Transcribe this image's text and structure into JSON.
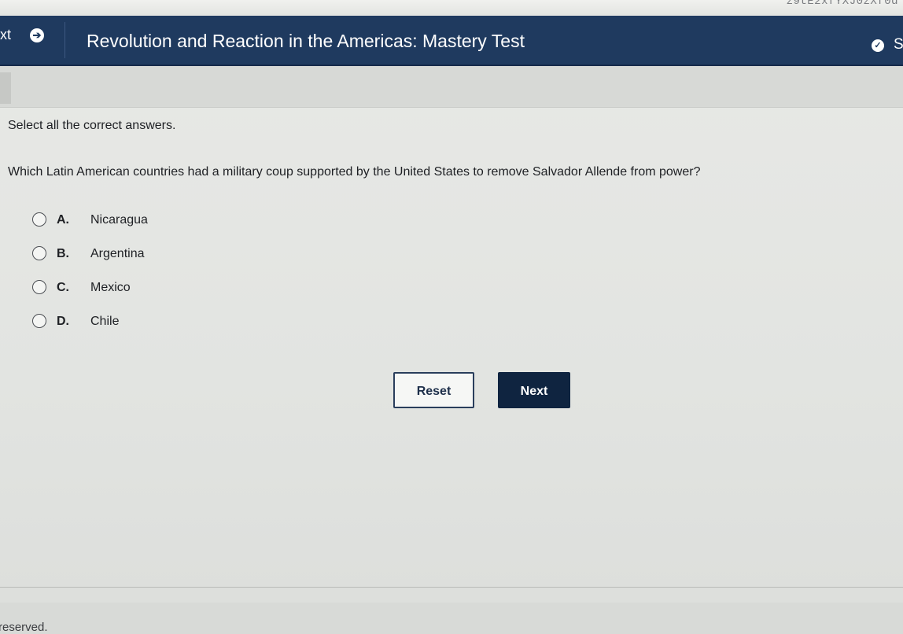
{
  "top_strip": {
    "url_fragment": "z9tE2xfYXJ0zXf0d"
  },
  "header": {
    "prev_label": "xt",
    "prev_icon": "arrow-right-circle-icon",
    "title": "Revolution and Reaction in the Americas: Mastery Test",
    "status_icon": "check-circle-icon",
    "right_label": "S",
    "colors": {
      "bar": "#1f3a5f",
      "text": "#ffffff"
    }
  },
  "question": {
    "instruction": "Select all the correct answers.",
    "prompt": "Which Latin American countries had a military coup supported by the United States to remove Salvador Allende from power?",
    "options": [
      {
        "letter": "A.",
        "text": "Nicaragua"
      },
      {
        "letter": "B.",
        "text": "Argentina"
      },
      {
        "letter": "C.",
        "text": "Mexico"
      },
      {
        "letter": "D.",
        "text": "Chile"
      }
    ]
  },
  "actions": {
    "reset_label": "Reset",
    "next_label": "Next"
  },
  "footer": {
    "text": "reserved."
  }
}
